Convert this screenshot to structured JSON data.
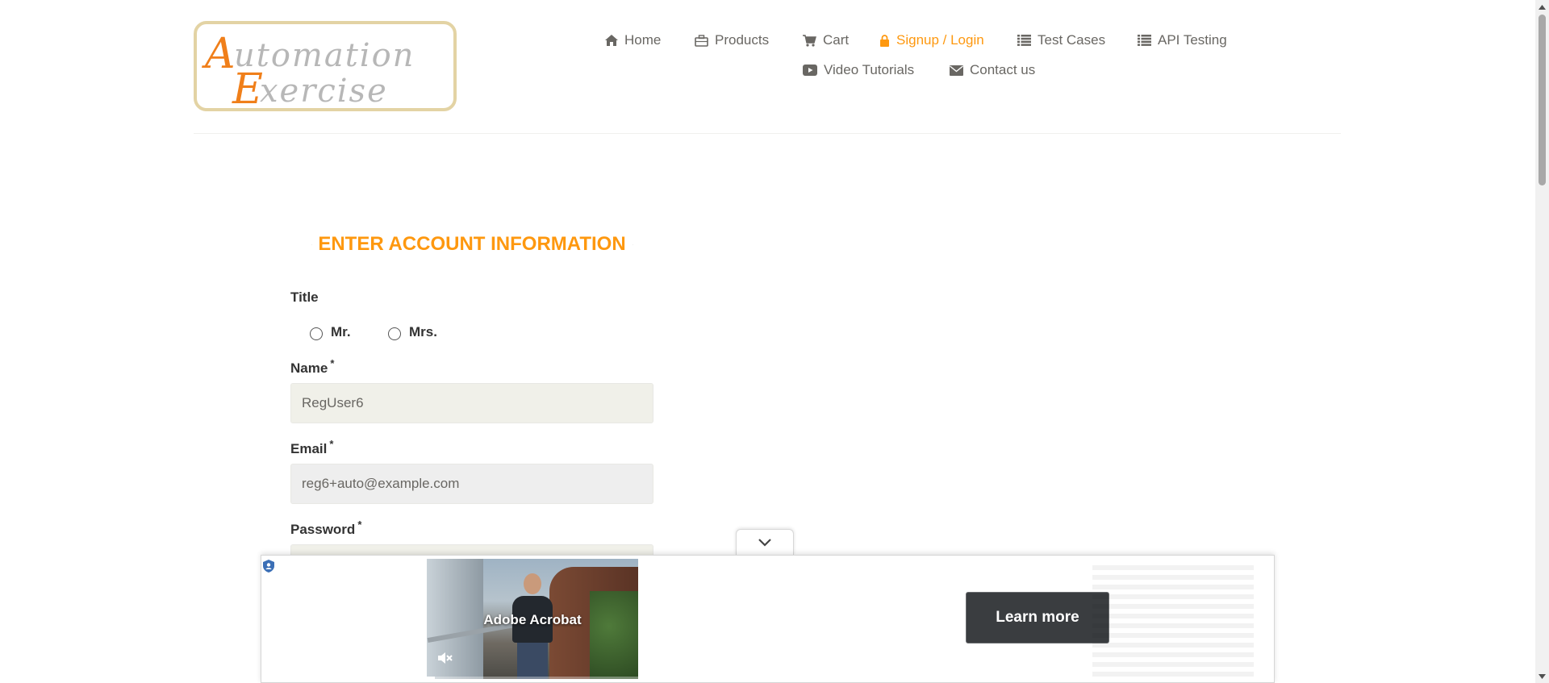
{
  "logo": {
    "line1": "Automation",
    "line2": "Exercise"
  },
  "nav": {
    "items": [
      {
        "label": "Home",
        "icon": "home-icon"
      },
      {
        "label": "Products",
        "icon": "briefcase-icon"
      },
      {
        "label": "Cart",
        "icon": "cart-icon"
      },
      {
        "label": "Signup / Login",
        "icon": "lock-icon",
        "active": true
      },
      {
        "label": "Test Cases",
        "icon": "list-icon"
      },
      {
        "label": "API Testing",
        "icon": "list-icon"
      },
      {
        "label": "Video Tutorials",
        "icon": "youtube-icon"
      },
      {
        "label": "Contact us",
        "icon": "envelope-icon"
      }
    ]
  },
  "form": {
    "section_title": "ENTER ACCOUNT INFORMATION",
    "title_label": "Title",
    "title_options": [
      "Mr.",
      "Mrs."
    ],
    "name_label": "Name",
    "name_value": "RegUser6",
    "email_label": "Email",
    "email_value": "reg6+auto@example.com",
    "password_label": "Password",
    "required_mark": "*"
  },
  "ad": {
    "brand": "Adobe Acrobat",
    "cta": "Learn more",
    "progress": 0.04
  },
  "colors": {
    "accent": "#FE980F",
    "nav_text": "#696763",
    "input_bg_name": "#F0F0E9",
    "input_bg_email": "#EEEEEE",
    "cta_bg": "#3A3D40"
  }
}
